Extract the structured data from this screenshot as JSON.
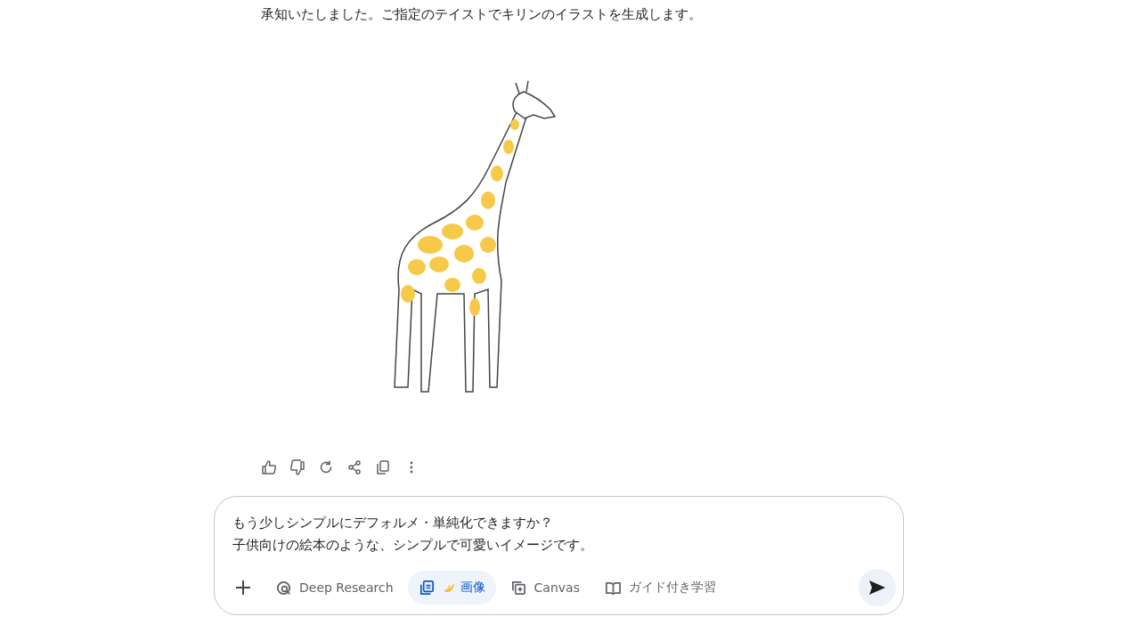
{
  "response": {
    "text": "承知いたしました。ご指定のテイストでキリンのイラストを生成します。"
  },
  "actions": [
    {
      "kind": "like"
    },
    {
      "kind": "dislike"
    },
    {
      "kind": "regenerate"
    },
    {
      "kind": "share"
    },
    {
      "kind": "copy"
    },
    {
      "kind": "more"
    }
  ],
  "prompt": {
    "lines": [
      "もう少しシンプルにデフォルメ・単純化できますか？",
      "子供向けの絵本のような、シンプルで可愛いイメージです。"
    ]
  },
  "tools": [
    {
      "kind": "deep-research",
      "label": "Deep Research",
      "selected": false
    },
    {
      "kind": "image",
      "label": "画像",
      "selected": true
    },
    {
      "kind": "canvas",
      "label": "Canvas",
      "selected": false
    },
    {
      "kind": "guided",
      "label": "ガイド付き学習",
      "selected": false
    }
  ]
}
